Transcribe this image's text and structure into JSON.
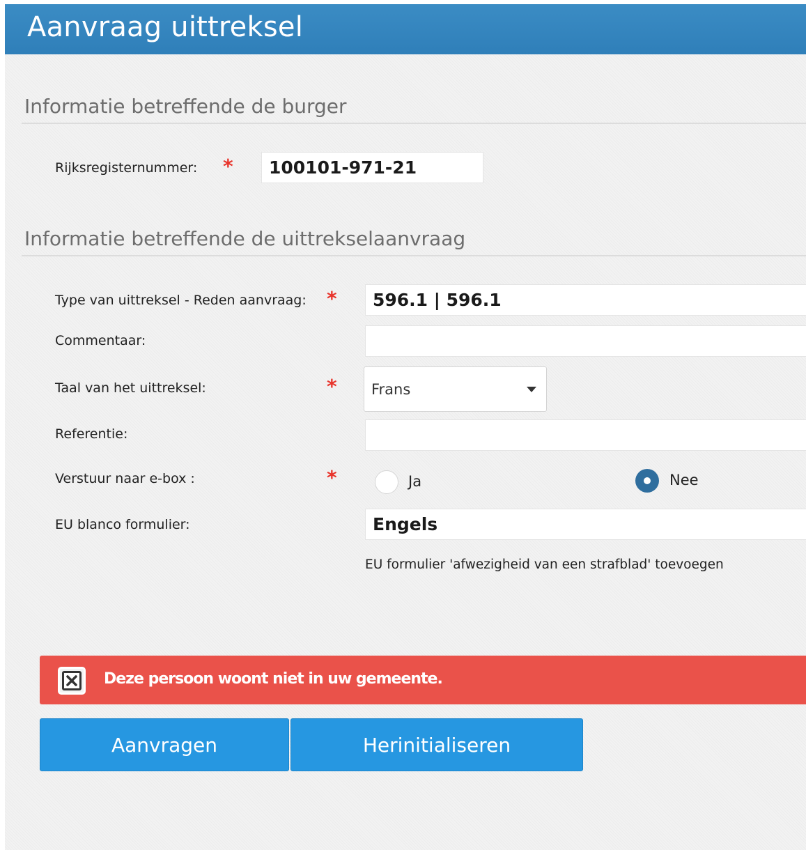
{
  "header": {
    "title": "Aanvraag uittreksel"
  },
  "sections": {
    "burger": {
      "title": "Informatie betreffende de burger"
    },
    "aanvraag": {
      "title": "Informatie betreffende de uittrekselaanvraag"
    }
  },
  "fields": {
    "rijksregisternummer": {
      "label": "Rijksregisternummer:",
      "required": "*",
      "value": "100101-971-21"
    },
    "type": {
      "label": "Type van uittreksel - Reden aanvraag:",
      "required": "*",
      "value": "596.1 | 596.1"
    },
    "commentaar": {
      "label": "Commentaar:",
      "value": ""
    },
    "taal": {
      "label": "Taal van het uittreksel:",
      "required": "*",
      "value": "Frans"
    },
    "referentie": {
      "label": "Referentie:",
      "value": ""
    },
    "ebox": {
      "label": "Verstuur naar e-box :",
      "required": "*",
      "options": [
        "Ja",
        "Nee"
      ],
      "selected": "Nee"
    },
    "eu_blanco": {
      "label": "EU blanco formulier:",
      "value": "Engels",
      "hint": "EU formulier 'afwezigheid van een strafblad' toevoegen"
    }
  },
  "alert": {
    "message": "Deze persoon woont niet in uw gemeente.",
    "icon": "close-box-icon",
    "color": "#ea524a"
  },
  "buttons": {
    "submit": "Aanvragen",
    "reset": "Herinitialiseren"
  },
  "colors": {
    "header": "#3585bf",
    "button": "#2697e1",
    "required": "#e8342b",
    "radio_selected": "#2f6e9e"
  }
}
